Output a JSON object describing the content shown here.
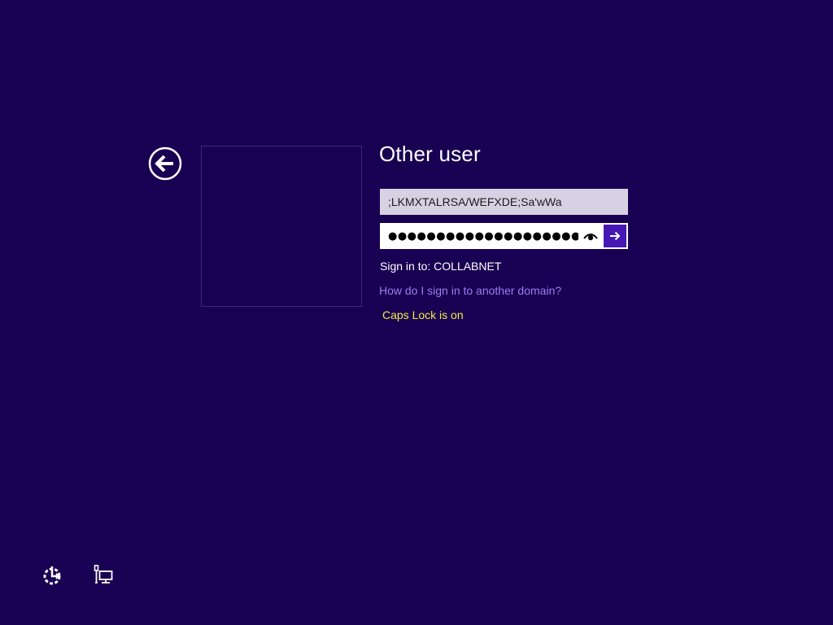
{
  "title": "Other user",
  "username": {
    "value": ";LKMXTALRSA/WEFXDE;Sa'wWa"
  },
  "password": {
    "masked_value": "●●●●●●●●●●●●●●●●●●●●●●●●●"
  },
  "sign_in_to": "Sign in to: COLLABNET",
  "help_link": "How do I sign in to another domain?",
  "caps_lock_warning": "Caps Lock is on",
  "icons": {
    "back": "back-arrow-icon",
    "reveal": "eye-icon",
    "submit": "arrow-right-icon",
    "ease_of_access": "ease-of-access-icon",
    "network": "network-icon"
  },
  "colors": {
    "background": "#180052",
    "submit_button": "#4617b4",
    "link": "#a17cf0",
    "warning": "#f5e94a",
    "username_field": "#d7d1e3"
  }
}
